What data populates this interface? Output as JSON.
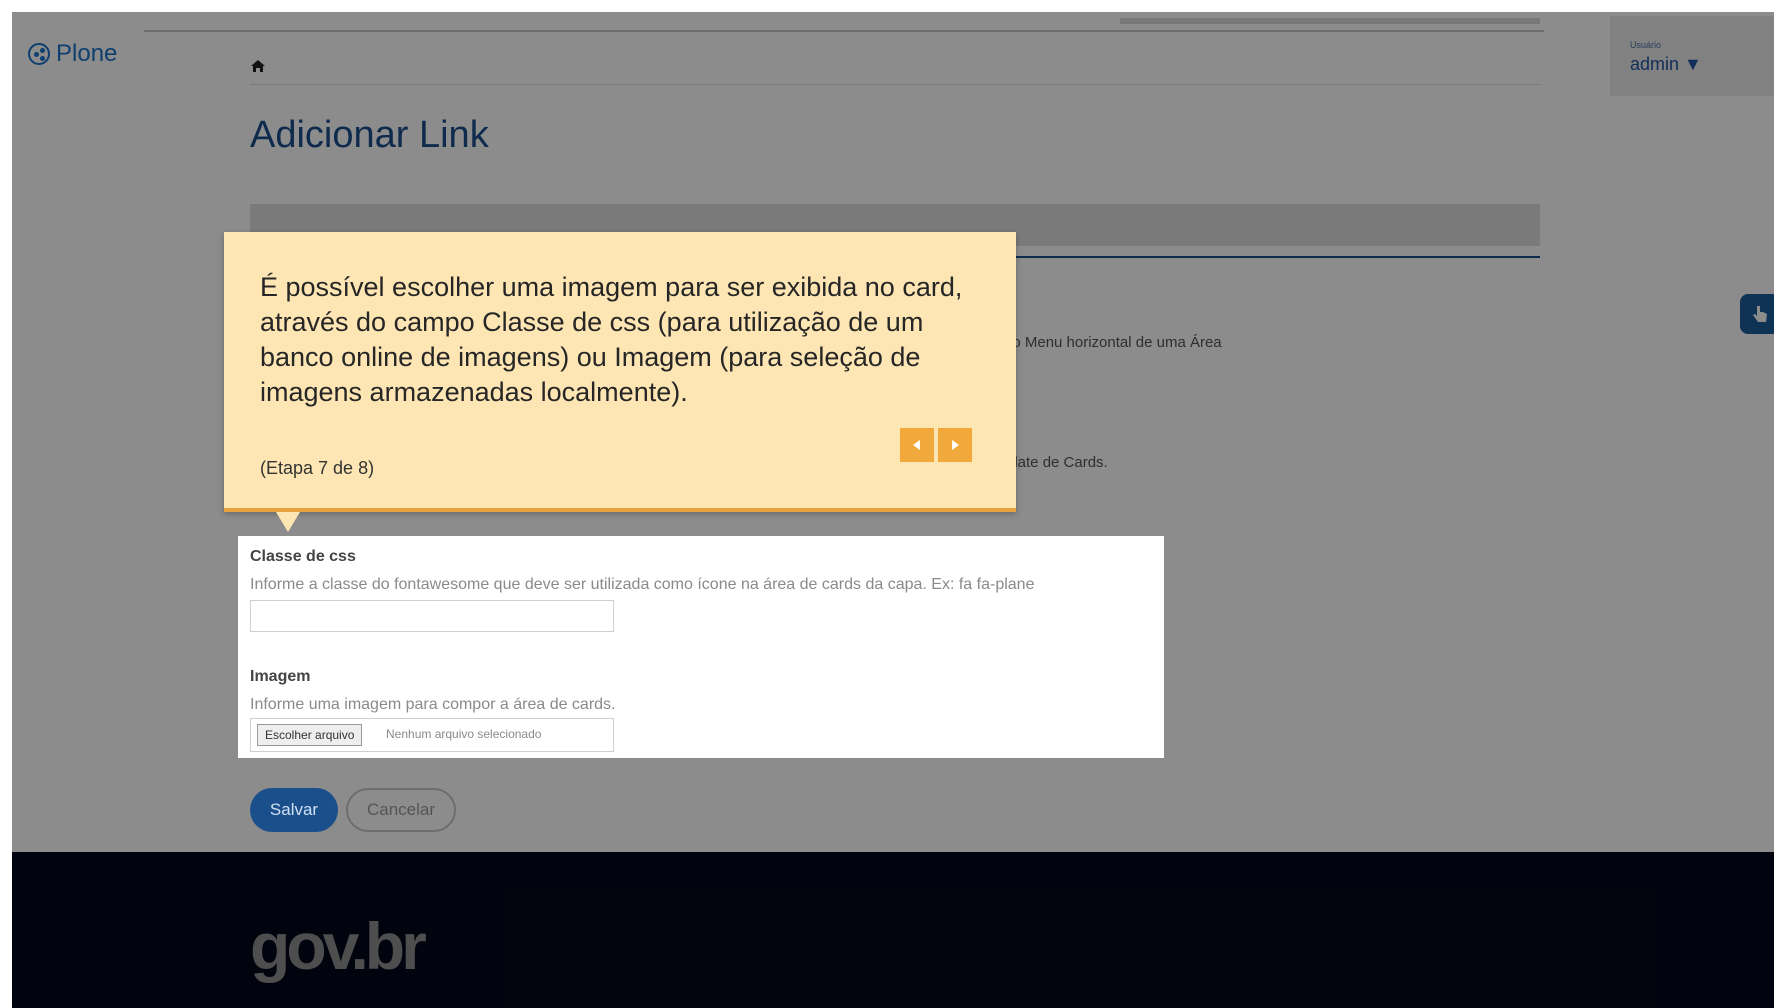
{
  "header": {
    "logo_text": "Plone",
    "user_small": "Usuário",
    "user_name": "admin ▼"
  },
  "page": {
    "title": "Adicionar Link",
    "bg_help_1": "do Menu horizontal de uma Área",
    "bg_help_2": "plate de Cards."
  },
  "tooltip": {
    "text": "É possível escolher uma imagem para ser exibida no card, através do campo Classe de css (para utilização de um banco online de imagens) ou Imagem (para seleção de imagens armazenadas localmente).",
    "step": "(Etapa 7 de 8)"
  },
  "fields": {
    "css": {
      "label": "Classe de css",
      "help": "Informe a classe do fontawesome que deve ser utilizada como ícone na área de cards da capa. Ex: fa fa-plane",
      "value": ""
    },
    "image": {
      "label": "Imagem",
      "help": "Informe uma imagem para compor a área de cards.",
      "button": "Escolher arquivo",
      "status": "Nenhum arquivo selecionado"
    }
  },
  "actions": {
    "save": "Salvar",
    "cancel": "Cancelar"
  },
  "footer": {
    "logo": "gov.br"
  },
  "colors": {
    "brand": "#1b4f8c",
    "tooltip_bg": "#fde6b3",
    "tooltip_accent": "#f0a93a",
    "footer_bg": "#03091a"
  }
}
